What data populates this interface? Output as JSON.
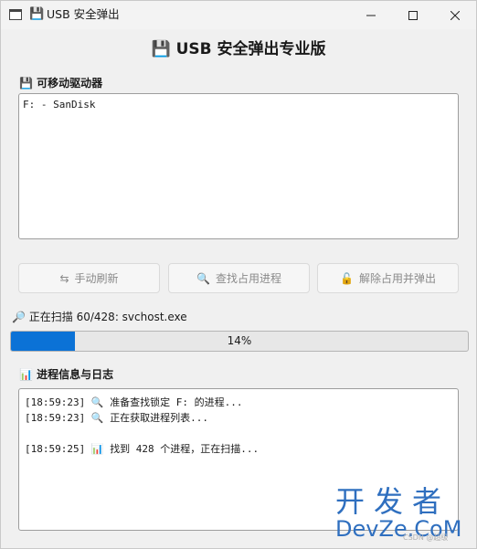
{
  "window": {
    "title_emoji": "💾",
    "title": "USB 安全弹出",
    "minimize_icon": "minimize-icon",
    "maximize_icon": "maximize-icon",
    "close_icon": "close-icon"
  },
  "heading": {
    "emoji": "💾",
    "text": "USB 安全弹出专业版"
  },
  "drives_section": {
    "emoji": "💾",
    "label": "可移动驱动器",
    "items": [
      "F: - SanDisk"
    ]
  },
  "buttons": {
    "refresh": {
      "icon": "⇆",
      "label": "手动刷新"
    },
    "find": {
      "icon": "🔍",
      "label": "查找占用进程"
    },
    "release": {
      "icon": "🔓",
      "label": "解除占用并弹出"
    }
  },
  "status": {
    "emoji": "🔎",
    "text": "正在扫描 60/428: svchost.exe"
  },
  "progress": {
    "percent": 14,
    "label": "14%",
    "color": "#0b72d6"
  },
  "log_section": {
    "emoji": "📊",
    "label": "进程信息与日志",
    "lines": [
      {
        "time": "[18:59:23]",
        "icon": "🔍",
        "text": "准备查找锁定 F: 的进程..."
      },
      {
        "time": "[18:59:23]",
        "icon": "🔍",
        "text": "正在获取进程列表..."
      },
      {
        "time": "",
        "icon": "",
        "text": ""
      },
      {
        "time": "[18:59:25]",
        "icon": "📊",
        "text": "找到 428 个进程，正在扫描..."
      }
    ]
  },
  "watermark": {
    "line1": "开发者",
    "line2": "DevZe.CoM",
    "line3": "CSDN @超级"
  }
}
